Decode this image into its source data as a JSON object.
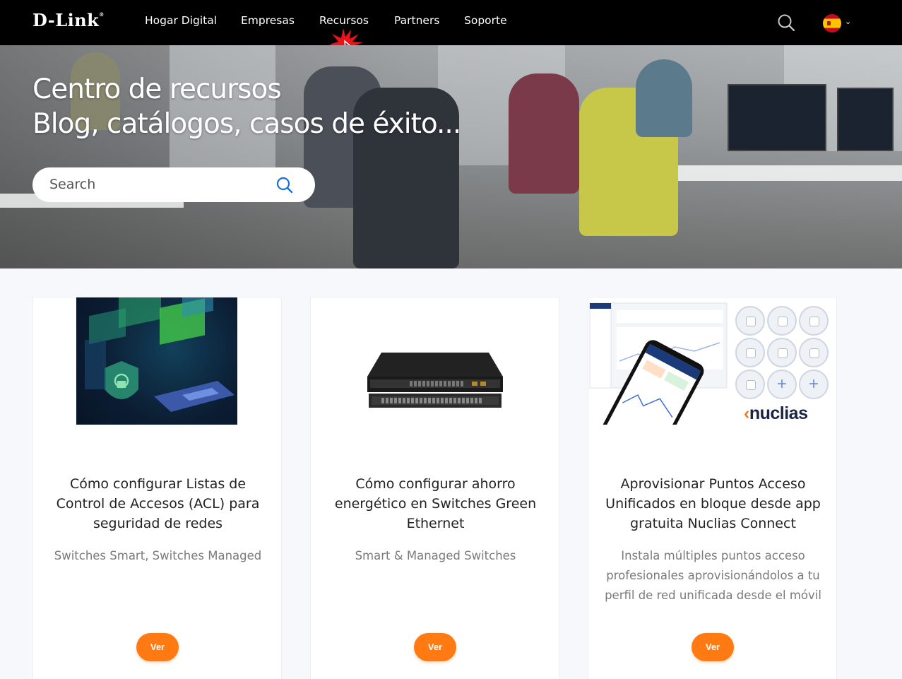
{
  "brand": {
    "logo_text": "D-Link",
    "logo_mark": "®"
  },
  "nav": {
    "items": [
      {
        "label": "Hogar Digital"
      },
      {
        "label": "Empresas"
      },
      {
        "label": "Recursos"
      },
      {
        "label": "Partners"
      },
      {
        "label": "Soporte"
      }
    ],
    "search_icon": "search-icon",
    "language": {
      "icon": "spain-flag-icon",
      "chevron": "chevron-down-icon"
    }
  },
  "hero": {
    "title_line1": "Centro de recursos",
    "title_line2": "Blog, catálogos, casos de éxito...",
    "search": {
      "placeholder": "Search",
      "value": ""
    }
  },
  "cards": [
    {
      "image": "network-security-illustration",
      "title": "Cómo configurar Listas de Control de Accesos (ACL) para seguridad de redes",
      "subtitle": "Switches Smart, Switches Managed",
      "button": "Ver"
    },
    {
      "image": "network-switches-photo",
      "title": "Cómo configurar ahorro energético en Switches Green Ethernet",
      "subtitle": "Smart & Managed Switches",
      "button": "Ver"
    },
    {
      "image": "nuclias-app-access-points",
      "title": "Aprovisionar Puntos Acceso Unificados en bloque desde app gratuita Nuclias Connect",
      "subtitle": "Instala múltiples puntos acceso profesionales aprovisionándolos a tu perfil de red unificada desde el móvil",
      "button": "Ver",
      "logo_text": "nuclias"
    }
  ],
  "colors": {
    "nav_bg": "#000000",
    "accent": "#ff7a13",
    "search_icon": "#1a6fd6"
  }
}
